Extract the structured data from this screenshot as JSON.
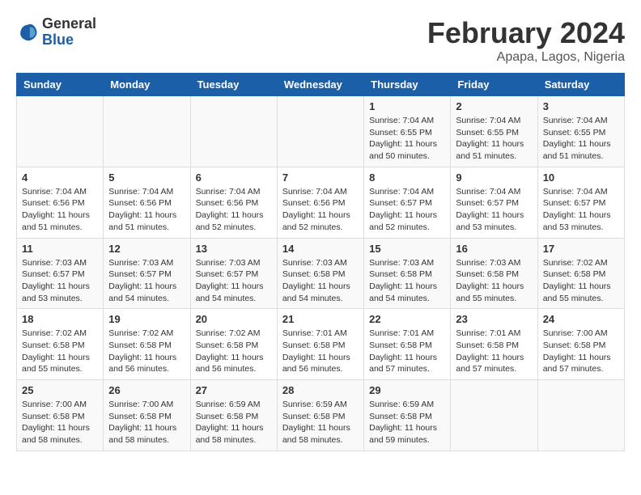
{
  "logo": {
    "general": "General",
    "blue": "Blue"
  },
  "title": "February 2024",
  "subtitle": "Apapa, Lagos, Nigeria",
  "days_header": [
    "Sunday",
    "Monday",
    "Tuesday",
    "Wednesday",
    "Thursday",
    "Friday",
    "Saturday"
  ],
  "weeks": [
    [
      {
        "day": "",
        "info": ""
      },
      {
        "day": "",
        "info": ""
      },
      {
        "day": "",
        "info": ""
      },
      {
        "day": "",
        "info": ""
      },
      {
        "day": "1",
        "info": "Sunrise: 7:04 AM\nSunset: 6:55 PM\nDaylight: 11 hours\nand 50 minutes."
      },
      {
        "day": "2",
        "info": "Sunrise: 7:04 AM\nSunset: 6:55 PM\nDaylight: 11 hours\nand 51 minutes."
      },
      {
        "day": "3",
        "info": "Sunrise: 7:04 AM\nSunset: 6:55 PM\nDaylight: 11 hours\nand 51 minutes."
      }
    ],
    [
      {
        "day": "4",
        "info": "Sunrise: 7:04 AM\nSunset: 6:56 PM\nDaylight: 11 hours\nand 51 minutes."
      },
      {
        "day": "5",
        "info": "Sunrise: 7:04 AM\nSunset: 6:56 PM\nDaylight: 11 hours\nand 51 minutes."
      },
      {
        "day": "6",
        "info": "Sunrise: 7:04 AM\nSunset: 6:56 PM\nDaylight: 11 hours\nand 52 minutes."
      },
      {
        "day": "7",
        "info": "Sunrise: 7:04 AM\nSunset: 6:56 PM\nDaylight: 11 hours\nand 52 minutes."
      },
      {
        "day": "8",
        "info": "Sunrise: 7:04 AM\nSunset: 6:57 PM\nDaylight: 11 hours\nand 52 minutes."
      },
      {
        "day": "9",
        "info": "Sunrise: 7:04 AM\nSunset: 6:57 PM\nDaylight: 11 hours\nand 53 minutes."
      },
      {
        "day": "10",
        "info": "Sunrise: 7:04 AM\nSunset: 6:57 PM\nDaylight: 11 hours\nand 53 minutes."
      }
    ],
    [
      {
        "day": "11",
        "info": "Sunrise: 7:03 AM\nSunset: 6:57 PM\nDaylight: 11 hours\nand 53 minutes."
      },
      {
        "day": "12",
        "info": "Sunrise: 7:03 AM\nSunset: 6:57 PM\nDaylight: 11 hours\nand 54 minutes."
      },
      {
        "day": "13",
        "info": "Sunrise: 7:03 AM\nSunset: 6:57 PM\nDaylight: 11 hours\nand 54 minutes."
      },
      {
        "day": "14",
        "info": "Sunrise: 7:03 AM\nSunset: 6:58 PM\nDaylight: 11 hours\nand 54 minutes."
      },
      {
        "day": "15",
        "info": "Sunrise: 7:03 AM\nSunset: 6:58 PM\nDaylight: 11 hours\nand 54 minutes."
      },
      {
        "day": "16",
        "info": "Sunrise: 7:03 AM\nSunset: 6:58 PM\nDaylight: 11 hours\nand 55 minutes."
      },
      {
        "day": "17",
        "info": "Sunrise: 7:02 AM\nSunset: 6:58 PM\nDaylight: 11 hours\nand 55 minutes."
      }
    ],
    [
      {
        "day": "18",
        "info": "Sunrise: 7:02 AM\nSunset: 6:58 PM\nDaylight: 11 hours\nand 55 minutes."
      },
      {
        "day": "19",
        "info": "Sunrise: 7:02 AM\nSunset: 6:58 PM\nDaylight: 11 hours\nand 56 minutes."
      },
      {
        "day": "20",
        "info": "Sunrise: 7:02 AM\nSunset: 6:58 PM\nDaylight: 11 hours\nand 56 minutes."
      },
      {
        "day": "21",
        "info": "Sunrise: 7:01 AM\nSunset: 6:58 PM\nDaylight: 11 hours\nand 56 minutes."
      },
      {
        "day": "22",
        "info": "Sunrise: 7:01 AM\nSunset: 6:58 PM\nDaylight: 11 hours\nand 57 minutes."
      },
      {
        "day": "23",
        "info": "Sunrise: 7:01 AM\nSunset: 6:58 PM\nDaylight: 11 hours\nand 57 minutes."
      },
      {
        "day": "24",
        "info": "Sunrise: 7:00 AM\nSunset: 6:58 PM\nDaylight: 11 hours\nand 57 minutes."
      }
    ],
    [
      {
        "day": "25",
        "info": "Sunrise: 7:00 AM\nSunset: 6:58 PM\nDaylight: 11 hours\nand 58 minutes."
      },
      {
        "day": "26",
        "info": "Sunrise: 7:00 AM\nSunset: 6:58 PM\nDaylight: 11 hours\nand 58 minutes."
      },
      {
        "day": "27",
        "info": "Sunrise: 6:59 AM\nSunset: 6:58 PM\nDaylight: 11 hours\nand 58 minutes."
      },
      {
        "day": "28",
        "info": "Sunrise: 6:59 AM\nSunset: 6:58 PM\nDaylight: 11 hours\nand 58 minutes."
      },
      {
        "day": "29",
        "info": "Sunrise: 6:59 AM\nSunset: 6:58 PM\nDaylight: 11 hours\nand 59 minutes."
      },
      {
        "day": "",
        "info": ""
      },
      {
        "day": "",
        "info": ""
      }
    ]
  ]
}
